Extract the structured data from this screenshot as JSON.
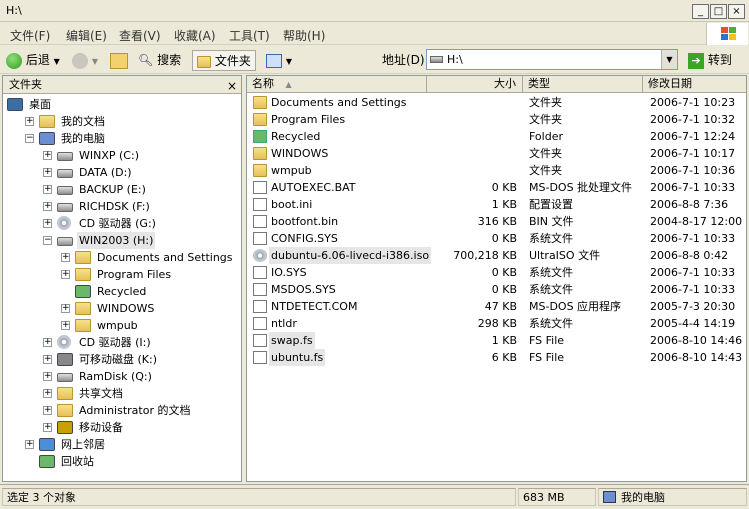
{
  "window": {
    "title": "H:\\",
    "min": "_",
    "max": "□",
    "close": "×"
  },
  "menu": [
    "文件(F)",
    "编辑(E)",
    "查看(V)",
    "收藏(A)",
    "工具(T)",
    "帮助(H)"
  ],
  "toolbar": {
    "back": "后退",
    "search": "搜索",
    "folders": "文件夹"
  },
  "address": {
    "label": "地址(D)",
    "value": "H:\\",
    "go": "转到"
  },
  "left_pane": {
    "title": "文件夹",
    "close": "×",
    "tree": [
      {
        "label": "桌面",
        "icon": "desktop-icon"
      },
      {
        "label": "我的文档",
        "icon": "folder-icon",
        "exp": "+"
      },
      {
        "label": "我的电脑",
        "icon": "computer-icon",
        "exp": "−"
      },
      {
        "label": "WINXP (C:)",
        "icon": "drive-icon",
        "exp": "+"
      },
      {
        "label": "DATA (D:)",
        "icon": "drive-icon",
        "exp": "+"
      },
      {
        "label": "BACKUP (E:)",
        "icon": "drive-icon",
        "exp": "+"
      },
      {
        "label": "RICHDSK (F:)",
        "icon": "drive-icon",
        "exp": "+"
      },
      {
        "label": "CD 驱动器 (G:)",
        "icon": "cd-icon",
        "exp": "+"
      },
      {
        "label": "WIN2003 (H:)",
        "icon": "drive-icon",
        "exp": "−",
        "selected": true
      },
      {
        "label": "Documents and Settings",
        "icon": "folder-icon",
        "exp": "+"
      },
      {
        "label": "Program Files",
        "icon": "folder-icon",
        "exp": "+"
      },
      {
        "label": "Recycled",
        "icon": "recycle-icon",
        "exp": ""
      },
      {
        "label": "WINDOWS",
        "icon": "folder-icon",
        "exp": "+"
      },
      {
        "label": "wmpub",
        "icon": "folder-icon",
        "exp": "+"
      },
      {
        "label": "CD 驱动器 (I:)",
        "icon": "cd-icon",
        "exp": "+"
      },
      {
        "label": "可移动磁盘 (K:)",
        "icon": "removable-icon",
        "exp": "+"
      },
      {
        "label": "RamDisk (Q:)",
        "icon": "drive-icon",
        "exp": "+"
      },
      {
        "label": "共享文档",
        "icon": "folder-icon",
        "exp": "+"
      },
      {
        "label": "Administrator 的文档",
        "icon": "folder-icon",
        "exp": "+"
      },
      {
        "label": "移动设备",
        "icon": "mobile-icon",
        "exp": "+"
      },
      {
        "label": "网上邻居",
        "icon": "network-icon",
        "exp": "+"
      },
      {
        "label": "回收站",
        "icon": "recycle-icon",
        "exp": ""
      }
    ]
  },
  "columns": {
    "name": "名称",
    "size": "大小",
    "type": "类型",
    "modified": "修改日期"
  },
  "files": [
    {
      "name": "Documents and Settings",
      "size": "",
      "type": "文件夹",
      "modified": "2006-7-1 10:23",
      "icon": "folder-icon"
    },
    {
      "name": "Program Files",
      "size": "",
      "type": "文件夹",
      "modified": "2006-7-1 10:32",
      "icon": "folder-icon"
    },
    {
      "name": "Recycled",
      "size": "",
      "type": "Folder",
      "modified": "2006-7-1 12:24",
      "icon": "recycle-icon"
    },
    {
      "name": "WINDOWS",
      "size": "",
      "type": "文件夹",
      "modified": "2006-7-1 10:17",
      "icon": "folder-icon"
    },
    {
      "name": "wmpub",
      "size": "",
      "type": "文件夹",
      "modified": "2006-7-1 10:36",
      "icon": "folder-icon"
    },
    {
      "name": "AUTOEXEC.BAT",
      "size": "0 KB",
      "type": "MS-DOS 批处理文件",
      "modified": "2006-7-1 10:33",
      "icon": "bat-icon"
    },
    {
      "name": "boot.ini",
      "size": "1 KB",
      "type": "配置设置",
      "modified": "2006-8-8 7:36",
      "icon": "ini-icon"
    },
    {
      "name": "bootfont.bin",
      "size": "316 KB",
      "type": "BIN 文件",
      "modified": "2004-8-17 12:00",
      "icon": "bin-icon"
    },
    {
      "name": "CONFIG.SYS",
      "size": "0 KB",
      "type": "系统文件",
      "modified": "2006-7-1 10:33",
      "icon": "sys-icon"
    },
    {
      "name": "dubuntu-6.06-livecd-i386.iso",
      "size": "700,218 KB",
      "type": "UltraISO 文件",
      "modified": "2006-8-8 0:42",
      "icon": "iso-icon",
      "selected": true
    },
    {
      "name": "IO.SYS",
      "size": "0 KB",
      "type": "系统文件",
      "modified": "2006-7-1 10:33",
      "icon": "sys-icon"
    },
    {
      "name": "MSDOS.SYS",
      "size": "0 KB",
      "type": "系统文件",
      "modified": "2006-7-1 10:33",
      "icon": "sys-icon"
    },
    {
      "name": "NTDETECT.COM",
      "size": "47 KB",
      "type": "MS-DOS 应用程序",
      "modified": "2005-7-3 20:30",
      "icon": "com-icon"
    },
    {
      "name": "ntldr",
      "size": "298 KB",
      "type": "系统文件",
      "modified": "2005-4-4 14:19",
      "icon": "sys-icon"
    },
    {
      "name": "swap.fs",
      "size": "1 KB",
      "type": "FS File",
      "modified": "2006-8-10 14:46",
      "icon": "fs-icon",
      "selected": true
    },
    {
      "name": "ubuntu.fs",
      "size": "6 KB",
      "type": "FS File",
      "modified": "2006-8-10 14:43",
      "icon": "fs-icon",
      "selected": true
    }
  ],
  "status": {
    "selection": "选定 3 个对象",
    "size": "683 MB",
    "location": "我的电脑"
  }
}
